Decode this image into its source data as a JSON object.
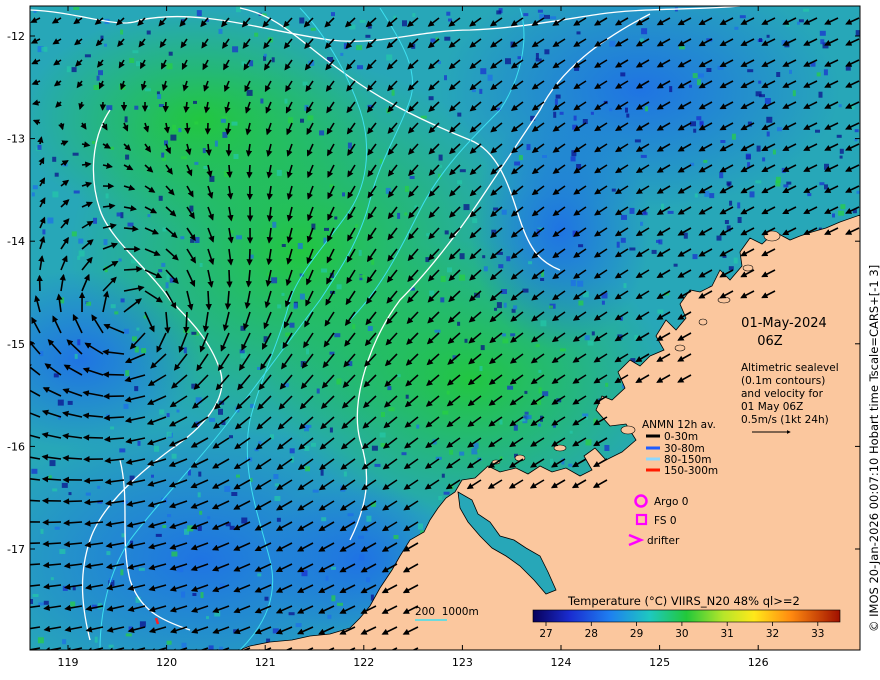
{
  "header": {
    "date": "01-May-2024",
    "time": "06Z"
  },
  "description": [
    "Altimetric sealevel",
    "(0.1m contours)",
    "and velocity for",
    "01 May 06Z",
    "0.5m/s (1kt 24h)"
  ],
  "anmn_legend": {
    "title": "ANMN 12h av.",
    "items": [
      {
        "label": "0-30m",
        "color": "#000000"
      },
      {
        "label": "30-80m",
        "color": "#1e5bff"
      },
      {
        "label": "80-150m",
        "color": "#8ed8ff"
      },
      {
        "label": "150-300m",
        "color": "#ff1a00"
      }
    ]
  },
  "obs_legend": {
    "argo": "Argo 0",
    "fs": "FS 0",
    "drifter": "drifter",
    "marker_color": "#ff00ff"
  },
  "depth_legend": {
    "text": "200  1000m"
  },
  "colorbar": {
    "title": "Temperature (°C) VIIRS_N20 48% ql>=2",
    "ticks": [
      "27",
      "28",
      "29",
      "30",
      "31",
      "32",
      "33"
    ]
  },
  "axes": {
    "x_ticks": [
      "119",
      "120",
      "121",
      "122",
      "123",
      "124",
      "125",
      "126"
    ],
    "y_ticks": [
      "-12",
      "-13",
      "-14",
      "-15",
      "-16",
      "-17"
    ]
  },
  "side_label": "© IMOS 20-Jan-2026 00:07:10 Hobart time Tscale=CARS+[-1 3]",
  "colors": {
    "land": "#fbc79e",
    "sst_cool": "#1e78e6",
    "sst_mid": "#23b4a0",
    "sst_warm": "#22c83a",
    "contour": "#ffffff",
    "isobath": "#3ee0f0"
  }
}
